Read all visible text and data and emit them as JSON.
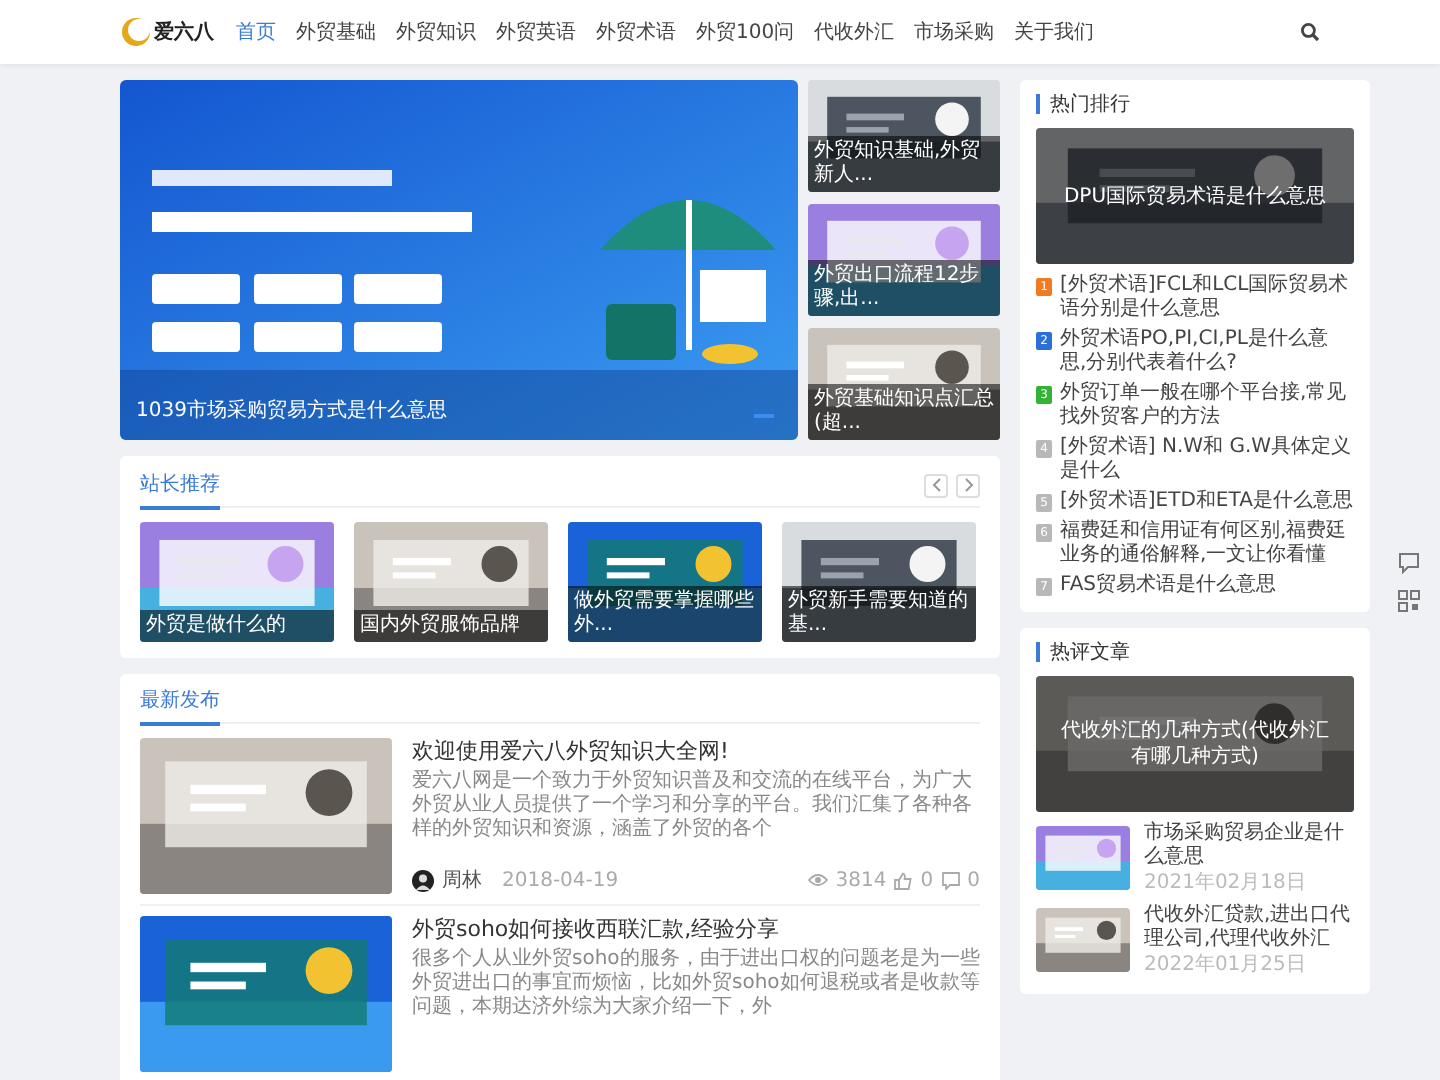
{
  "header": {
    "logo_text": "爱六八",
    "nav": [
      {
        "label": "首页",
        "selected": true
      },
      {
        "label": "外贸基础",
        "selected": false
      },
      {
        "label": "外贸知识",
        "selected": false
      },
      {
        "label": "外贸英语",
        "selected": false
      },
      {
        "label": "外贸术语",
        "selected": false
      },
      {
        "label": "外贸100问",
        "selected": false
      },
      {
        "label": "代收外汇",
        "selected": false
      },
      {
        "label": "市场采购",
        "selected": false
      },
      {
        "label": "关于我们",
        "selected": false
      }
    ]
  },
  "banner": {
    "caption": "1039市场采购贸易方式是什么意思"
  },
  "side_posts": [
    {
      "caption": "外贸知识基础,外贸新人..."
    },
    {
      "caption": "外贸出口流程12步骤,出..."
    },
    {
      "caption": "外贸基础知识点汇总(超..."
    }
  ],
  "recommend": {
    "title": "站长推荐",
    "items": [
      {
        "caption": "外贸是做什么的"
      },
      {
        "caption": "国内外贸服饰品牌"
      },
      {
        "caption": "做外贸需要掌握哪些外..."
      },
      {
        "caption": "外贸新手需要知道的基..."
      }
    ]
  },
  "latest": {
    "title": "最新发布",
    "posts": [
      {
        "title": "欢迎使用爱六八外贸知识大全网!",
        "excerpt": "爱六八网是一个致力于外贸知识普及和交流的在线平台，为广大外贸从业人员提供了一个学习和分享的平台。我们汇集了各种各样的外贸知识和资源，涵盖了外贸的各个",
        "author": "周林",
        "date": "2018-04-19",
        "views": "3814",
        "likes": "0",
        "comments": "0"
      },
      {
        "title": "外贸soho如何接收西联汇款,经验分享",
        "excerpt": "很多个人从业外贸soho的服务，由于进出口权的问题老是为一些外贸进出口的事宜而烦恼，比如外贸soho如何退税或者是收款等问题，本期达济外综为大家介绍一下，外"
      }
    ]
  },
  "hot_ranking": {
    "title": "热门排行",
    "feature_caption": "DPU国际贸易术语是什么意思",
    "items": [
      {
        "rank": "1",
        "color": "#f07b22",
        "text": "[外贸术语]FCL和LCL国际贸易术语分别是什么意思"
      },
      {
        "rank": "2",
        "color": "#2d6fd8",
        "text": "外贸术语PO,PI,CI,PL是什么意思,分别代表着什么?"
      },
      {
        "rank": "3",
        "color": "#34b233",
        "text": "外贸订单一般在哪个平台接,常见找外贸客户的方法"
      },
      {
        "rank": "4",
        "color": "#b8b8b8",
        "text": "[外贸术语] N.W和 G.W具体定义是什么"
      },
      {
        "rank": "5",
        "color": "#b8b8b8",
        "text": "[外贸术语]ETD和ETA是什么意思"
      },
      {
        "rank": "6",
        "color": "#b8b8b8",
        "text": "福费廷和信用证有何区别,福费廷业务的通俗解释,一文让你看懂"
      },
      {
        "rank": "7",
        "color": "#b8b8b8",
        "text": "FAS贸易术语是什么意思"
      }
    ]
  },
  "hot_comments": {
    "title": "热评文章",
    "feature_caption": "代收外汇的几种方式(代收外汇有哪几种方式)",
    "items": [
      {
        "title": "市场采购贸易企业是什么意思",
        "date": "2021年02月18日"
      },
      {
        "title": "代收外汇贷款,进出口代理公司,代理代收外汇",
        "date": "2022年01月25日"
      }
    ]
  }
}
